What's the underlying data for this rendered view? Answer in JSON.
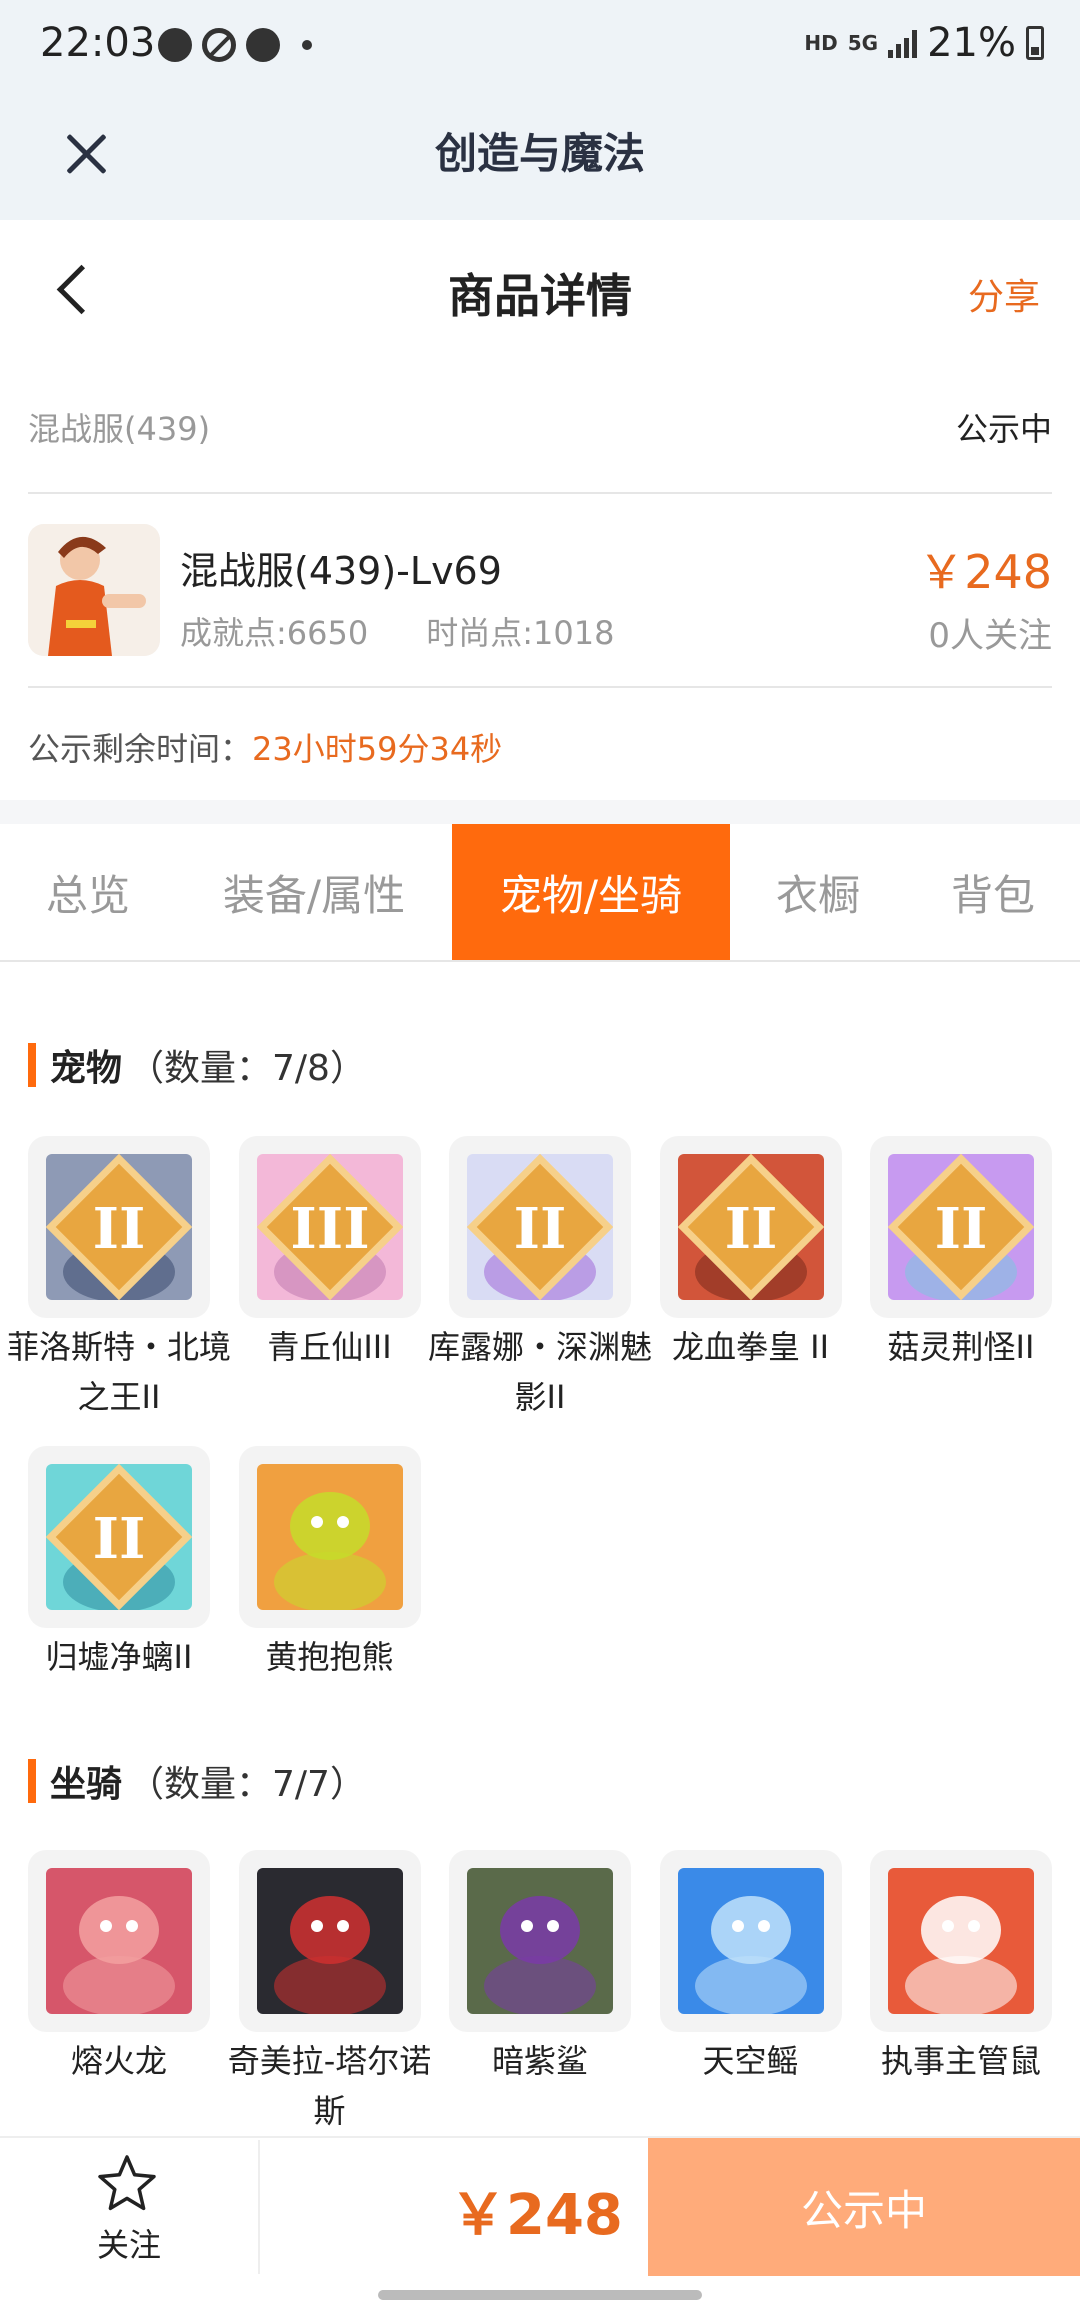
{
  "status_bar": {
    "time": "22:03",
    "hd": "HD",
    "network": "5G",
    "battery": "21%"
  },
  "app": {
    "title": "创造与魔法"
  },
  "page": {
    "title": "商品详情",
    "share_label": "分享"
  },
  "server": {
    "name": "混战服(439)",
    "status": "公示中"
  },
  "product": {
    "name": "混战服(439)-Lv69",
    "achievement": "成就点:6650",
    "fashion": "时尚点:1018",
    "price": "￥248",
    "followers": "0人关注"
  },
  "countdown": {
    "label": "公示剩余时间：",
    "value": "23小时59分34秒"
  },
  "tabs": [
    {
      "label": "总览"
    },
    {
      "label": "装备/属性"
    },
    {
      "label": "宠物/坐骑"
    },
    {
      "label": "衣橱"
    },
    {
      "label": "背包"
    }
  ],
  "active_tab": "宠物/坐骑",
  "pets": {
    "title": "宠物",
    "count": "（数量：7/8）",
    "items": [
      {
        "label": "菲洛斯特・北境之王II",
        "badge": "II",
        "color": "#8e9ab5",
        "accent": "#3b4b6e"
      },
      {
        "label": "青丘仙III",
        "badge": "III",
        "color": "#f3b8d8",
        "accent": "#c07ab0"
      },
      {
        "label": "库露娜・深渊魅影II",
        "badge": "II",
        "color": "#d9dcf4",
        "accent": "#a06ad8"
      },
      {
        "label": "龙血拳皇 II",
        "badge": "II",
        "color": "#d2553a",
        "accent": "#7a2a1c"
      },
      {
        "label": "菇灵荆怪II",
        "badge": "II",
        "color": "#c79af0",
        "accent": "#7cc6e0"
      },
      {
        "label": "归墟净螭II",
        "badge": "II",
        "color": "#6fd6d8",
        "accent": "#2f8ea0"
      },
      {
        "label": "黄抱抱熊",
        "badge": "",
        "color": "#f0a040",
        "accent": "#c6dc2a"
      }
    ]
  },
  "mounts": {
    "title": "坐骑",
    "count": "（数量：7/7）",
    "items": [
      {
        "label": "熔火龙",
        "color": "#d6566a",
        "accent": "#f3a0a0"
      },
      {
        "label": "奇美拉-塔尔诺斯",
        "color": "#2a2a30",
        "accent": "#d03030"
      },
      {
        "label": "暗紫鲨",
        "color": "#5a6a4a",
        "accent": "#7a3aa8"
      },
      {
        "label": "天空鳐",
        "color": "#3a8ae8",
        "accent": "#bfe0fa"
      },
      {
        "label": "执事主管鼠",
        "color": "#e85a3a",
        "accent": "#ffffff"
      }
    ]
  },
  "bottom": {
    "follow_label": "关注",
    "price": "￥248",
    "status_label": "公示中"
  }
}
